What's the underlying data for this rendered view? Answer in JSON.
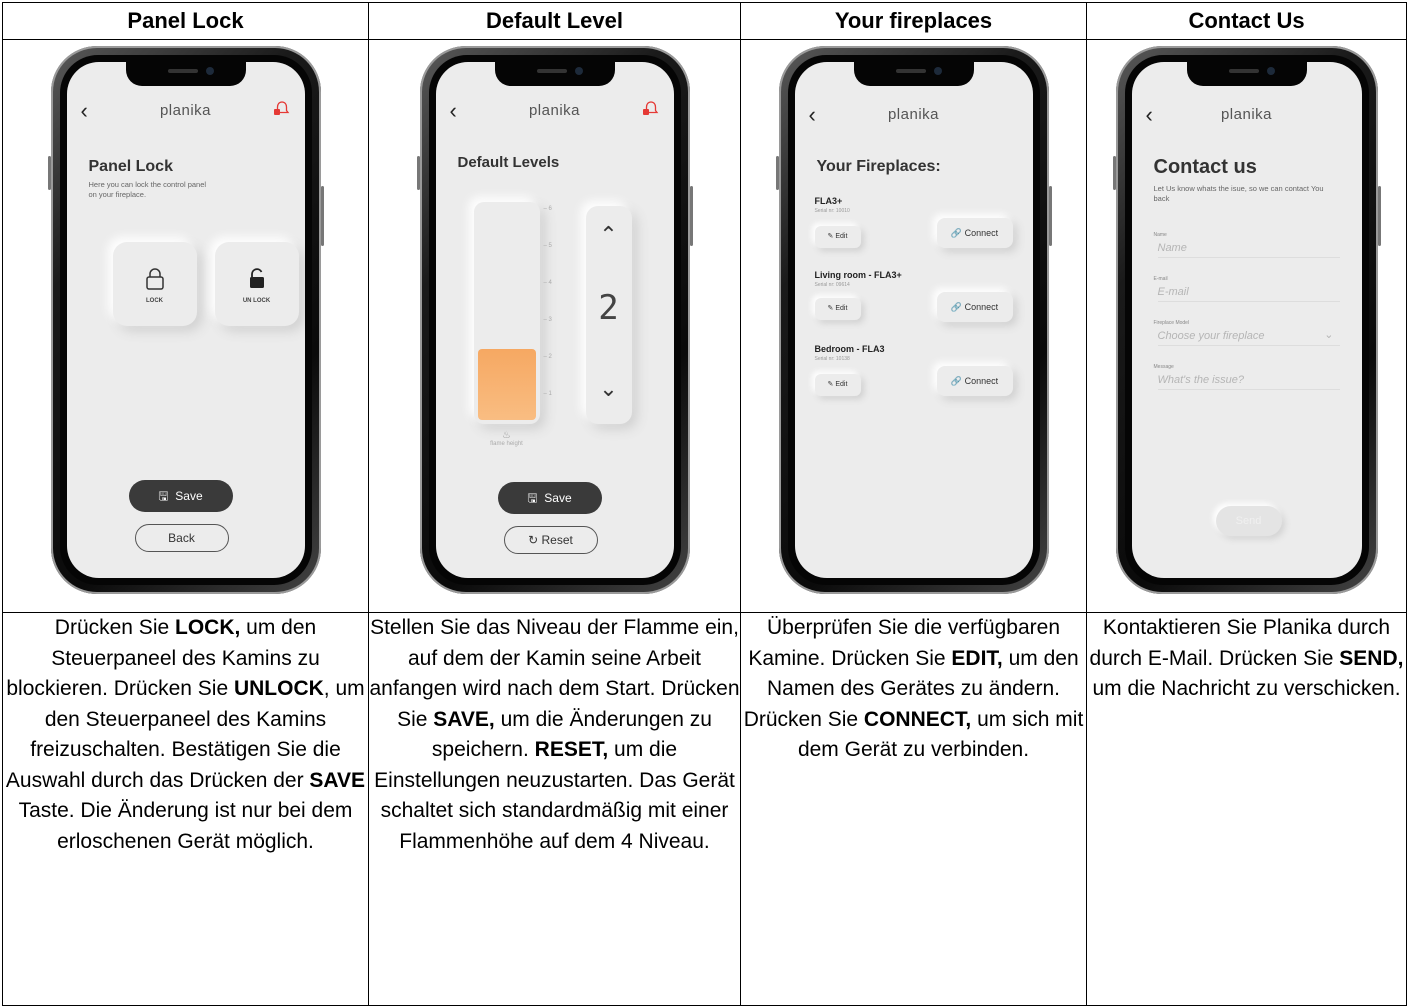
{
  "headers": [
    "Panel Lock",
    "Default Level",
    "Your fireplaces",
    "Contact Us"
  ],
  "app": {
    "brand": "planika"
  },
  "panel_lock": {
    "title": "Panel Lock",
    "subtitle": "Here you can lock the control panel on your fireplace.",
    "lock_label": "LOCK",
    "unlock_label": "UN LOCK",
    "save_label": "Save",
    "back_label": "Back"
  },
  "default_level": {
    "title": "Default Levels",
    "scale_ticks": [
      "6",
      "5",
      "4",
      "3",
      "2",
      "1"
    ],
    "current_level": "2",
    "level_value": 2,
    "level_max": 6,
    "bar_caption": "flame height",
    "save_label": "Save",
    "reset_label": "Reset"
  },
  "fireplaces": {
    "title": "Your Fireplaces:",
    "edit_label": "Edit",
    "connect_label": "Connect",
    "items": [
      {
        "name": "FLA3+",
        "serial": "Serial nr: 10010"
      },
      {
        "name": "Living room - FLA3+",
        "serial": "Serial nr: 09614"
      },
      {
        "name": "Bedroom - FLA3",
        "serial": "Serial nr: 10138"
      }
    ]
  },
  "contact": {
    "title": "Contact us",
    "subtitle": "Let Us know whats the isue, so we can contact You back",
    "name_label": "Name",
    "name_placeholder": "Name",
    "email_label": "E-mail",
    "email_placeholder": "E-mail",
    "model_label": "Fireplace Model",
    "model_placeholder": "Choose your fireplace",
    "message_label": "Message",
    "message_placeholder": "What's the issue?",
    "send_label": "Send"
  },
  "descriptions": {
    "c1": {
      "p1": "Drücken Sie ",
      "b1": "LOCK,",
      "p2": " um den Steuerpaneel des Kamins zu blockieren. Drücken Sie ",
      "b2": "UNLOCK",
      "p3": ", um den Steuerpaneel des Kamins freizuschalten. Bestätigen Sie die Auswahl durch das Drücken der ",
      "b3": "SAVE",
      "p4": " Taste. Die Änderung ist nur bei dem erloschenen Gerät möglich."
    },
    "c2": {
      "p1": "Stellen Sie das Niveau der Flamme ein, auf dem der Kamin seine Arbeit anfangen wird nach dem Start. Drücken Sie ",
      "b1": "SAVE,",
      "p2": " um die Änderungen zu speichern. ",
      "b2": "RESET,",
      "p3": "  um die Einstellungen  neuzustarten. Das Gerät schaltet sich standardmäßig mit einer Flammenhöhe auf dem 4 Niveau."
    },
    "c3": {
      "p1": "Überprüfen Sie die verfügbaren Kamine. Drücken Sie ",
      "b1": "EDIT,",
      "p2": " um den Namen des Gerätes zu ändern. Drücken Sie ",
      "b2": "CONNECT,",
      "p3": " um sich mit dem Gerät zu verbinden."
    },
    "c4": {
      "p1": "Kontaktieren Sie Planika durch durch E-Mail. Drücken Sie ",
      "b1": "SEND,",
      "p2": " um die Nachricht zu verschicken."
    }
  },
  "colors": {
    "flame_bar": "#f6a862",
    "dark_button": "#3a3a3a",
    "bell_badge": "#e53935"
  }
}
